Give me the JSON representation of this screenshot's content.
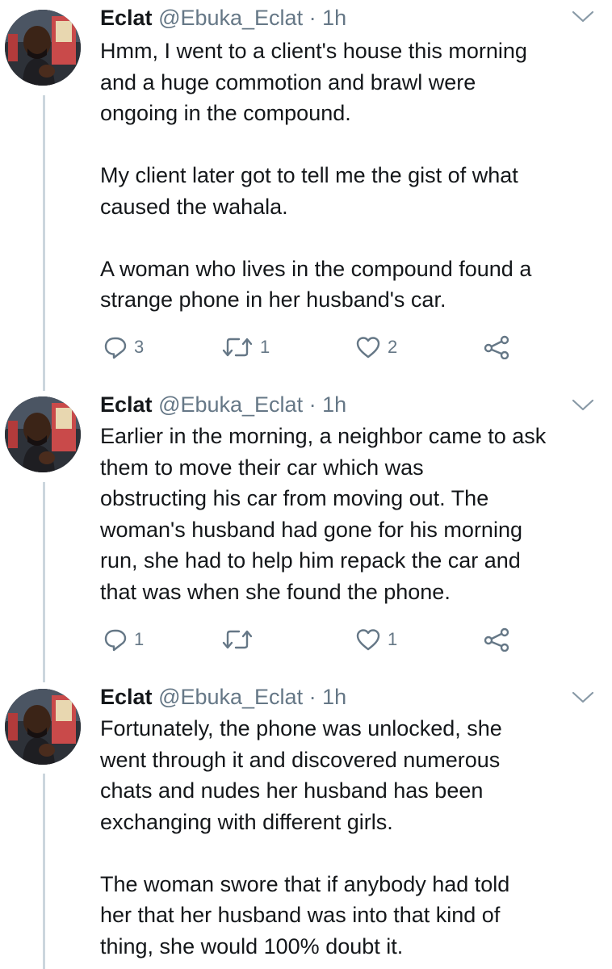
{
  "tweets": [
    {
      "name": "Eclat",
      "handle": "@Ebuka_Eclat",
      "separator": "·",
      "time": "1h",
      "text": "Hmm, I went to a client's house this morning\nand a huge commotion and brawl were\nongoing in the compound.\n\nMy client later got to tell me the gist of what\ncaused the wahala.\n\nA woman who lives in the compound found a\nstrange phone in her husband's car.",
      "reply_count": "3",
      "retweet_count": "1",
      "like_count": "2"
    },
    {
      "name": "Eclat",
      "handle": "@Ebuka_Eclat",
      "separator": "·",
      "time": "1h",
      "text": "Earlier in the morning, a neighbor came to ask\nthem to move their car which was\nobstructing his car from moving out. The\nwoman's husband had gone for his morning\nrun, she had to help him repack the car and\nthat was when she found the phone.",
      "reply_count": "1",
      "retweet_count": "",
      "like_count": "1"
    },
    {
      "name": "Eclat",
      "handle": "@Ebuka_Eclat",
      "separator": "·",
      "time": "1h",
      "text": "Fortunately, the phone was unlocked, she\nwent through it and discovered numerous\nchats and nudes her husband has been\nexchanging with different girls.\n\nThe woman swore that if anybody had told\nher that her husband was into that kind of\nthing, she would 100% doubt it."
    }
  ],
  "icons": {
    "reply": "reply-icon",
    "retweet": "retweet-icon",
    "like": "heart-icon",
    "share": "share-icon",
    "caret": "chevron-down-icon"
  },
  "colors": {
    "text": "#14171a",
    "secondary": "#657786",
    "thread_line": "#ccd6dd"
  }
}
